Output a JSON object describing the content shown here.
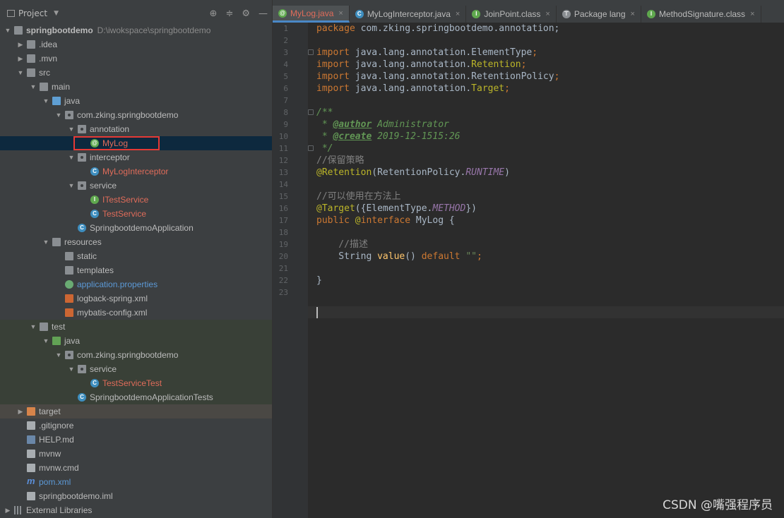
{
  "project_panel": {
    "title": "Project",
    "tree": [
      {
        "label": "springbootdemo",
        "suffix": "D:\\iwokspace\\springbootdemo",
        "indent": 0,
        "arrow": "down",
        "icon": "folder",
        "color": "grey",
        "bold": true
      },
      {
        "label": ".idea",
        "indent": 1,
        "arrow": "right",
        "icon": "folder",
        "color": "grey"
      },
      {
        "label": ".mvn",
        "indent": 1,
        "arrow": "right",
        "icon": "folder",
        "color": "grey"
      },
      {
        "label": "src",
        "indent": 1,
        "arrow": "down",
        "icon": "folder",
        "color": "grey"
      },
      {
        "label": "main",
        "indent": 2,
        "arrow": "down",
        "icon": "folder",
        "color": "grey"
      },
      {
        "label": "java",
        "indent": 3,
        "arrow": "down",
        "icon": "folder-blue",
        "color": "grey"
      },
      {
        "label": "com.zking.springbootdemo",
        "indent": 4,
        "arrow": "down",
        "icon": "package",
        "color": "grey"
      },
      {
        "label": "annotation",
        "indent": 5,
        "arrow": "down",
        "icon": "package",
        "color": "grey"
      },
      {
        "label": "MyLog",
        "indent": 6,
        "arrow": "none",
        "icon": "annotation",
        "color": "red",
        "selected": true
      },
      {
        "label": "interceptor",
        "indent": 5,
        "arrow": "down",
        "icon": "package",
        "color": "grey"
      },
      {
        "label": "MyLogInterceptor",
        "indent": 6,
        "arrow": "none",
        "icon": "class",
        "color": "red"
      },
      {
        "label": "service",
        "indent": 5,
        "arrow": "down",
        "icon": "package",
        "color": "grey"
      },
      {
        "label": "ITestService",
        "indent": 6,
        "arrow": "none",
        "icon": "interface",
        "color": "red"
      },
      {
        "label": "TestService",
        "indent": 6,
        "arrow": "none",
        "icon": "class",
        "color": "red"
      },
      {
        "label": "SpringbootdemoApplication",
        "indent": 5,
        "arrow": "none",
        "icon": "class",
        "color": "grey"
      },
      {
        "label": "resources",
        "indent": 3,
        "arrow": "down",
        "icon": "folder",
        "color": "grey"
      },
      {
        "label": "static",
        "indent": 4,
        "arrow": "none",
        "icon": "folder",
        "color": "grey"
      },
      {
        "label": "templates",
        "indent": 4,
        "arrow": "none",
        "icon": "folder",
        "color": "grey"
      },
      {
        "label": "application.properties",
        "indent": 4,
        "arrow": "none",
        "icon": "spring",
        "color": "blue"
      },
      {
        "label": "logback-spring.xml",
        "indent": 4,
        "arrow": "none",
        "icon": "xml",
        "color": "grey"
      },
      {
        "label": "mybatis-config.xml",
        "indent": 4,
        "arrow": "none",
        "icon": "xml",
        "color": "grey"
      },
      {
        "label": "test",
        "indent": 2,
        "arrow": "down",
        "icon": "folder",
        "color": "grey",
        "band": "test"
      },
      {
        "label": "java",
        "indent": 3,
        "arrow": "down",
        "icon": "folder-green",
        "color": "grey",
        "band": "test"
      },
      {
        "label": "com.zking.springbootdemo",
        "indent": 4,
        "arrow": "down",
        "icon": "package",
        "color": "grey",
        "band": "test"
      },
      {
        "label": "service",
        "indent": 5,
        "arrow": "down",
        "icon": "package",
        "color": "grey",
        "band": "test"
      },
      {
        "label": "TestServiceTest",
        "indent": 6,
        "arrow": "none",
        "icon": "class",
        "color": "red",
        "band": "test"
      },
      {
        "label": "SpringbootdemoApplicationTests",
        "indent": 5,
        "arrow": "none",
        "icon": "class",
        "color": "grey",
        "band": "test"
      },
      {
        "label": "target",
        "indent": 1,
        "arrow": "right",
        "icon": "folder-orange",
        "color": "grey",
        "band": "target"
      },
      {
        "label": ".gitignore",
        "indent": 1,
        "arrow": "none",
        "icon": "file",
        "color": "grey"
      },
      {
        "label": "HELP.md",
        "indent": 1,
        "arrow": "none",
        "icon": "md",
        "color": "grey"
      },
      {
        "label": "mvnw",
        "indent": 1,
        "arrow": "none",
        "icon": "file",
        "color": "grey"
      },
      {
        "label": "mvnw.cmd",
        "indent": 1,
        "arrow": "none",
        "icon": "file",
        "color": "grey"
      },
      {
        "label": "pom.xml",
        "indent": 1,
        "arrow": "none",
        "icon": "maven",
        "color": "blue"
      },
      {
        "label": "springbootdemo.iml",
        "indent": 1,
        "arrow": "none",
        "icon": "file",
        "color": "grey"
      },
      {
        "label": "External Libraries",
        "indent": 0,
        "arrow": "right",
        "icon": "libs",
        "color": "grey"
      }
    ]
  },
  "tabs": [
    {
      "label": "MyLog.java",
      "icon": "@",
      "icon_color": "#5fa84e",
      "active": true
    },
    {
      "label": "MyLogInterceptor.java",
      "icon": "C",
      "icon_color": "#3e8ebf"
    },
    {
      "label": "JoinPoint.class",
      "icon": "I",
      "icon_color": "#5fa84e"
    },
    {
      "label": "Package lang",
      "icon": "⊤",
      "icon_color": "#8a8e92"
    },
    {
      "label": "MethodSignature.class",
      "icon": "I",
      "icon_color": "#5fa84e"
    }
  ],
  "code_lines": [
    [
      [
        "kw",
        "package "
      ],
      [
        "p",
        "com.zking.springbootdemo.annotation;"
      ]
    ],
    [],
    [
      [
        "kw",
        "import "
      ],
      [
        "p",
        "java.lang.annotation.ElementType"
      ],
      [
        "kw",
        ";"
      ]
    ],
    [
      [
        "kw",
        "import "
      ],
      [
        "p",
        "java.lang.annotation."
      ],
      [
        "ann",
        "Retention"
      ],
      [
        "kw",
        ";"
      ]
    ],
    [
      [
        "kw",
        "import "
      ],
      [
        "p",
        "java.lang.annotation.RetentionPolicy"
      ],
      [
        "kw",
        ";"
      ]
    ],
    [
      [
        "kw",
        "import "
      ],
      [
        "p",
        "java.lang.annotation."
      ],
      [
        "ann",
        "Target"
      ],
      [
        "kw",
        ";"
      ]
    ],
    [],
    [
      [
        "doc",
        "/**"
      ]
    ],
    [
      [
        "doc",
        " * "
      ],
      [
        "doctag",
        "@author"
      ],
      [
        "doc",
        " Administrator"
      ]
    ],
    [
      [
        "doc",
        " * "
      ],
      [
        "doctag",
        "@create"
      ],
      [
        "doc",
        " 2019-12-1515:26"
      ]
    ],
    [
      [
        "doc",
        " */"
      ]
    ],
    [
      [
        "cmt",
        "//保留策略"
      ]
    ],
    [
      [
        "ann",
        "@Retention"
      ],
      [
        "p",
        "(RetentionPolicy."
      ],
      [
        "it",
        "RUNTIME"
      ],
      [
        "p",
        ")"
      ]
    ],
    [],
    [
      [
        "cmt",
        "//可以使用在方法上"
      ]
    ],
    [
      [
        "ann",
        "@Target"
      ],
      [
        "p",
        "({ElementType."
      ],
      [
        "it",
        "METHOD"
      ],
      [
        "p",
        "})"
      ]
    ],
    [
      [
        "kw",
        "public "
      ],
      [
        "ann",
        "@"
      ],
      [
        "kw",
        "interface "
      ],
      [
        "p",
        "MyLog {"
      ]
    ],
    [],
    [
      [
        "cmt",
        "    //描述"
      ]
    ],
    [
      [
        "p",
        "    String "
      ],
      [
        "fn",
        "value"
      ],
      [
        "p",
        "() "
      ],
      [
        "kw",
        "default "
      ],
      [
        "str",
        "\"\""
      ],
      [
        "kw",
        ";"
      ]
    ],
    [],
    [
      [
        "p",
        "}"
      ]
    ],
    []
  ],
  "watermark": "CSDN @嘴强程序员"
}
